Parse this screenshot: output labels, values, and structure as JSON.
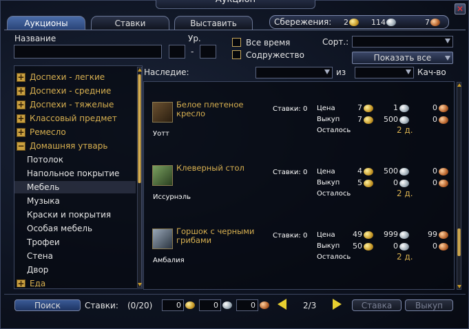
{
  "window": {
    "title": "Аукцион"
  },
  "tabs": [
    {
      "label": "Аукционы"
    },
    {
      "label": "Ставки"
    },
    {
      "label": "Выставить"
    }
  ],
  "savings": {
    "label": "Сбережения:",
    "gold": "2",
    "silver": "114",
    "copper": "7"
  },
  "search": {
    "name_label": "Название",
    "level_label": "Ур.",
    "level_sep": "-",
    "all_time": "Все время",
    "fellowship": "Содружество",
    "sort_label": "Сорт.:",
    "show_all": "Показать все"
  },
  "filters": {
    "heritage_label": "Наследие:",
    "of_label": "из",
    "quality_label": "Кач-во"
  },
  "categories": [
    {
      "label": "Доспехи - легкие",
      "type": "plus"
    },
    {
      "label": "Доспехи - средние",
      "type": "plus"
    },
    {
      "label": "Доспехи - тяжелые",
      "type": "plus"
    },
    {
      "label": "Классовый предмет",
      "type": "plus"
    },
    {
      "label": "Ремесло",
      "type": "plus"
    },
    {
      "label": "Домашняя утварь",
      "type": "minus"
    },
    {
      "label": "Потолок",
      "type": "sub"
    },
    {
      "label": "Напольное покрытие",
      "type": "sub"
    },
    {
      "label": "Мебель",
      "type": "sub",
      "selected": true
    },
    {
      "label": "Музыка",
      "type": "sub"
    },
    {
      "label": "Краски и покрытия",
      "type": "sub"
    },
    {
      "label": "Особая мебель",
      "type": "sub"
    },
    {
      "label": "Трофеи",
      "type": "sub"
    },
    {
      "label": "Стена",
      "type": "sub"
    },
    {
      "label": "Двор",
      "type": "sub"
    },
    {
      "label": "Еда",
      "type": "plus"
    }
  ],
  "listing_labels": {
    "bids": "Ставки:",
    "price": "Цена",
    "buyout": "Выкуп",
    "remaining": "Осталось"
  },
  "items": [
    {
      "name": "Белое плетеное кресло",
      "seller": "Уотт",
      "bids": "0",
      "price": {
        "g": "7",
        "s": "1",
        "c": "0"
      },
      "buyout": {
        "g": "7",
        "s": "500",
        "c": "0"
      },
      "remaining": "2 д."
    },
    {
      "name": "Клеверный стол",
      "seller": "Иссурнэль",
      "bids": "0",
      "price": {
        "g": "4",
        "s": "500",
        "c": "0"
      },
      "buyout": {
        "g": "5",
        "s": "0",
        "c": "0"
      },
      "remaining": "2 д."
    },
    {
      "name": "Горшок с черными грибами",
      "seller": "Амбалия",
      "bids": "0",
      "price": {
        "g": "49",
        "s": "999",
        "c": "99"
      },
      "buyout": {
        "g": "50",
        "s": "0",
        "c": "0"
      },
      "remaining": "2 д."
    }
  ],
  "footer": {
    "search_btn": "Поиск",
    "bids_label": "Ставки:",
    "bids_count": "(0/20)",
    "bid_g": "0",
    "bid_s": "0",
    "bid_c": "0",
    "page": "2/3",
    "bid_btn": "Ставка",
    "buyout_btn": "Выкуп"
  },
  "colors": {
    "gold_text": "#d8b050",
    "tab_active": "#3a5a96"
  }
}
